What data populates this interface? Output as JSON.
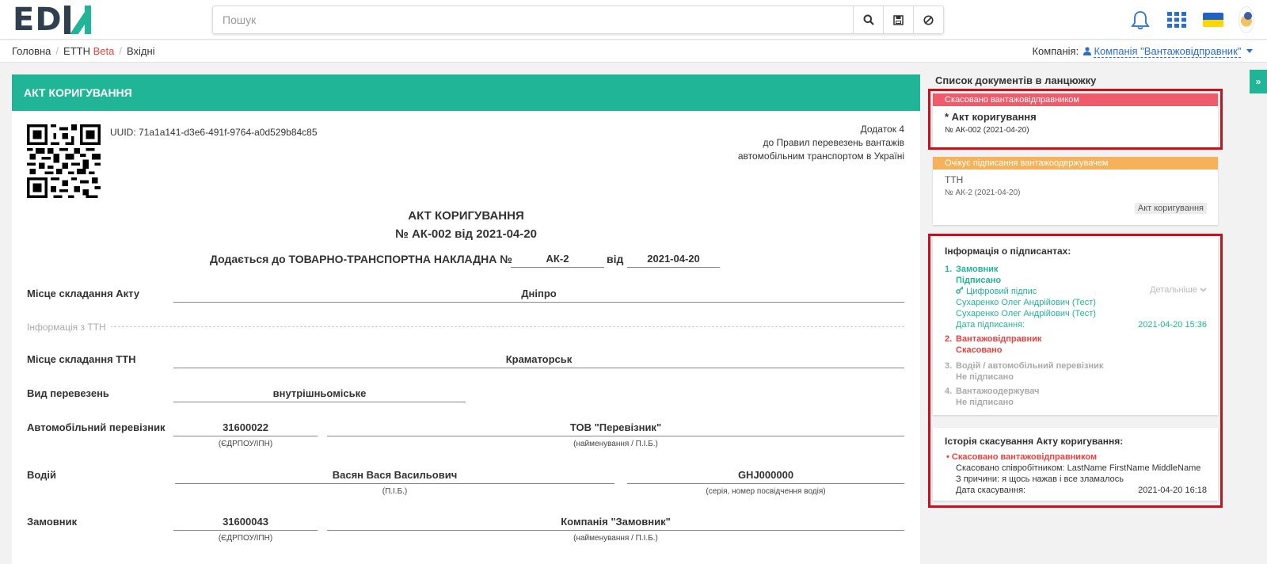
{
  "header": {
    "search_placeholder": "Пошук"
  },
  "breadcrumb": {
    "home": "Головна",
    "etth": "ЕТТН",
    "beta": "Beta",
    "current": "Вхідні"
  },
  "company": {
    "label": "Компанія:",
    "value": "Компанія \"Вантажовідправник\""
  },
  "document": {
    "header_title": "АКТ КОРИГУВАННЯ",
    "uuid_label": "UUID: 71a1a141-d3e6-491f-9764-a0d529b84c85",
    "appendix_line1": "Додаток 4",
    "appendix_line2": "до Правил перевезень вантажів",
    "appendix_line3": "автомобільним транспортом в Україні",
    "title": "АКТ КОРИГУВАННЯ",
    "number_line": "№ АК-002 від 2021-04-20",
    "attach_text": "Додається до ТОВАРНО-ТРАНСПОРТНА НАКЛАДНА №",
    "attach_number": "АК-2",
    "attach_from": "від",
    "attach_date": "2021-04-20",
    "place_label": "Місце складання Акту",
    "place_value": "Дніпро",
    "tth_info_label": "Інформація з ТТН",
    "tth_place_label": "Місце складання ТТН",
    "tth_place_value": "Краматорськ",
    "transport_type_label": "Вид перевезень",
    "transport_type_value": "внутрішньоміське",
    "carrier_label": "Автомобільний перевізник",
    "carrier_code": "31600022",
    "carrier_code_hint": "(ЄДРПОУ/ІПН)",
    "carrier_name": "ТОВ \"Перевізник\"",
    "carrier_name_hint": "(найменування / П.І.Б.)",
    "driver_label": "Водій",
    "driver_name": "Васян Вася Васильович",
    "driver_name_hint": "(П.І.Б.)",
    "driver_license": "GHJ000000",
    "driver_license_hint": "(серія, номер посвідчення водія)",
    "customer_label": "Замовник",
    "customer_code": "31600043",
    "customer_code_hint": "(ЄДРПОУ/ІПН)",
    "customer_name": "Компанія \"Замовник\"",
    "customer_name_hint": "(найменування / П.І.Б.)"
  },
  "sidebar": {
    "chain_title": "Список документів в ланцюжку",
    "chain": [
      {
        "status": "Скасовано вантажовідправником",
        "status_color": "#ee5b6a",
        "title": "* Акт коригування",
        "number": "№ АК-002 (2021-04-20)"
      },
      {
        "status": "Очікує підписання вантажоодержувачем",
        "status_color": "#f6b25a",
        "title": "ТТН",
        "number": "№ АК-2 (2021-04-20)",
        "tag": "Акт коригування"
      }
    ],
    "signers": {
      "title": "Інформація о підписантах:",
      "details_link": "Детальніше",
      "items": [
        {
          "num": "1.",
          "role": "Замовник",
          "status": "Підписано",
          "sig_type": "Цифровий підпис",
          "person1": "Сухаренко Олег Андрійович (Тест)",
          "person2": "Сухаренко Олег Андрійович (Тест)",
          "date_label": "Дата підписання:",
          "date_value": "2021-04-20 15:36"
        },
        {
          "num": "2.",
          "role": "Вантажовідправник",
          "status": "Скасовано"
        },
        {
          "num": "3.",
          "role": "Водій / автомобільний перевізник",
          "status": "Не підписано"
        },
        {
          "num": "4.",
          "role": "Вантажоодержувач",
          "status": "Не підписано"
        }
      ]
    },
    "history": {
      "title": "Історія скасування Акту коригування:",
      "status": "Скасовано вантажовідправником",
      "by": "Скасовано співробітником: LastName FirstName MiddleName",
      "reason": "З причини: я щось нажав і все зламалось",
      "date_label": "Дата скасування:",
      "date_value": "2021-04-20 16:18"
    }
  },
  "colors": {
    "accent": "#1fb596",
    "danger": "#e8413f",
    "highlight_border": "#c9101c",
    "link": "#2a6fc9"
  }
}
